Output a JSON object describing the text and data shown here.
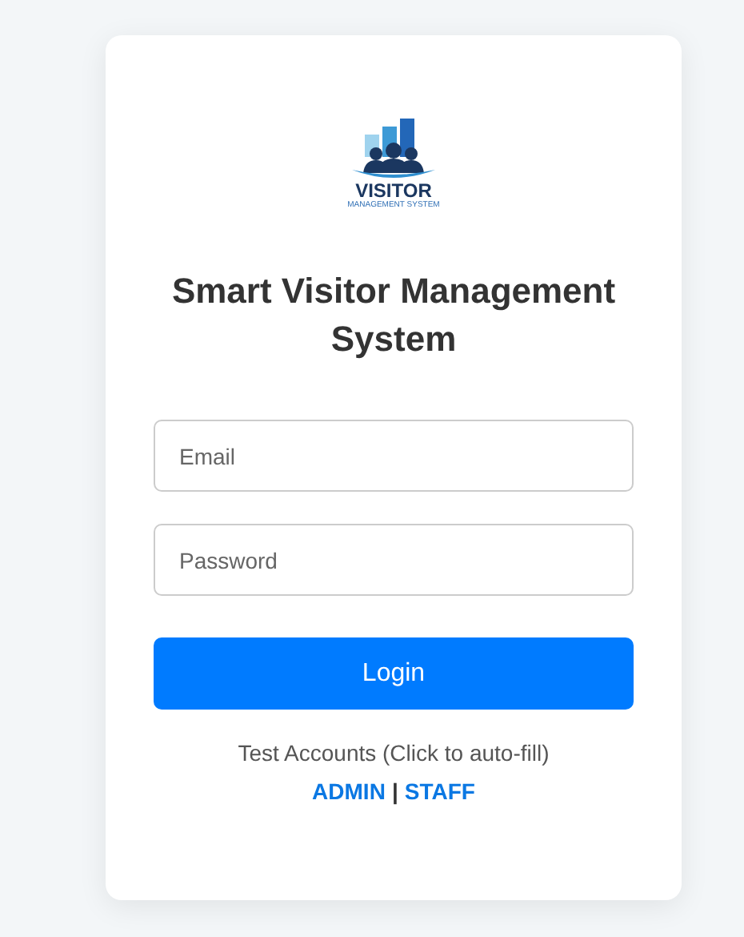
{
  "logo": {
    "title": "VISITOR",
    "subtitle": "MANAGEMENT SYSTEM"
  },
  "heading": "Smart Visitor Management System",
  "fields": [
    {
      "placeholder": "Email"
    },
    {
      "placeholder": "Password"
    }
  ],
  "login_button": "Login",
  "test_accounts": {
    "caption": "Test Accounts (Click to auto-fill)",
    "links": [
      "ADMIN",
      "STAFF"
    ],
    "separator": "|"
  }
}
